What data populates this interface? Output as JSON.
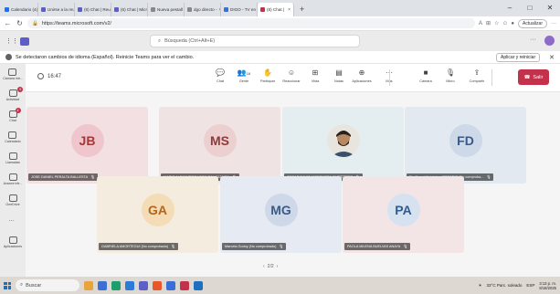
{
  "browser": {
    "tabs": [
      {
        "label": "Calendario (4)",
        "color": "#1a73e8",
        "active": false
      },
      {
        "label": "Unirse a la reu",
        "color": "#5b5fc7",
        "active": false
      },
      {
        "label": "(8) Chat | Reun",
        "color": "#5b5fc7",
        "active": false
      },
      {
        "label": "(6) Chat | Micr",
        "color": "#5b5fc7",
        "active": false
      },
      {
        "label": "Nueva pestañ",
        "color": "#888888",
        "active": false
      },
      {
        "label": "dgo directo -",
        "color": "#888888",
        "active": false
      },
      {
        "label": "DIGO - TV en",
        "color": "#3b6fd6",
        "active": false
      },
      {
        "label": "(8) Chat |",
        "color": "#c4314b",
        "active": true
      }
    ],
    "new_tab": "+",
    "window_controls": [
      "–",
      "□",
      "✕"
    ],
    "url": "https://teams.microsoft.com/v2/",
    "update_label": "Actualizar"
  },
  "teams": {
    "search_placeholder": "Búsqueda (Ctrl+Alt+E)",
    "more": "···",
    "banner_text": "Se detectaron cambios de idioma (Español). Reinicie Teams para ver el cambio.",
    "banner_action": "Aplicar y reiniciar",
    "rail": [
      {
        "label": "Cámara intr...",
        "badge": ""
      },
      {
        "label": "Actividad",
        "badge": "9"
      },
      {
        "label": "Chat",
        "badge": "4"
      },
      {
        "label": "Calendario",
        "badge": ""
      },
      {
        "label": "Llamadas",
        "badge": ""
      },
      {
        "label": "Avance intr...",
        "badge": ""
      },
      {
        "label": "OneDrive",
        "badge": ""
      },
      {
        "label": "",
        "badge": ""
      },
      {
        "label": "Aplicaciones",
        "badge": ""
      }
    ],
    "timer": "16:47",
    "controls": [
      {
        "label": "Chat",
        "glyph": "💬"
      },
      {
        "label": "Gente",
        "glyph": "👥",
        "count": "16"
      },
      {
        "label": "Participar",
        "glyph": "✋"
      },
      {
        "label": "Reaccionar",
        "glyph": "☺"
      },
      {
        "label": "Vista",
        "glyph": "⊞"
      },
      {
        "label": "Notas",
        "glyph": "▤"
      },
      {
        "label": "Aplicaciones",
        "glyph": "⊕"
      },
      {
        "label": "Más",
        "glyph": "···"
      },
      {
        "label": "Cámara",
        "glyph": "■"
      },
      {
        "label": "Micro",
        "glyph": "🎙"
      },
      {
        "label": "Compartir",
        "glyph": "⇪"
      }
    ],
    "leave_label": "Salir",
    "participants": [
      {
        "initials": "JB",
        "name": "JOSE DANIEL PERALTA BALLESTA",
        "tile_bg": "#f3e0e2",
        "av_bg": "#efc6cc",
        "av_fg": "#a4373a",
        "photo": false
      },
      {
        "initials": "MS",
        "name": "MARIO ALEJANDRO LEON SALAMANCA",
        "tile_bg": "#f0e3e3",
        "av_bg": "#ecd0d0",
        "av_fg": "#8c3a3a",
        "photo": false
      },
      {
        "initials": "",
        "name": "OSCAR DAVID MOSQUERA GUTIERREZ",
        "tile_bg": "#e4eef0",
        "av_bg": "#ffffff",
        "av_fg": "#333333",
        "photo": true
      },
      {
        "initials": "FD",
        "name": "Fireflies.ai Notetaker OSCAR D (No comproba...",
        "tile_bg": "#e3e9f0",
        "av_bg": "#cdd9e8",
        "av_fg": "#385a84",
        "photo": false
      },
      {
        "initials": "GA",
        "name": "GABRIELA AMORTEGUI (No comprobado)",
        "tile_bg": "#f4ecdf",
        "av_bg": "#f3dcb6",
        "av_fg": "#b3661c",
        "photo": false
      },
      {
        "initials": "MG",
        "name": "Marcela Godoy (No comprobado)",
        "tile_bg": "#e6eaf2",
        "av_bg": "#cfd8e8",
        "av_fg": "#3d5a87",
        "photo": false
      },
      {
        "initials": "PA",
        "name": "PAOLA MILENA BUELVAS ANAYA",
        "tile_bg": "#f3e5e5",
        "av_bg": "#d7e2f0",
        "av_fg": "#2f5c8f",
        "photo": false
      }
    ],
    "pager": "2/2"
  },
  "taskbar": {
    "search": "Buscar",
    "weather": "33°C  Parc. soleado",
    "lang": "ESP",
    "time": "3:13 p. m.",
    "date": "8/18/2025"
  }
}
